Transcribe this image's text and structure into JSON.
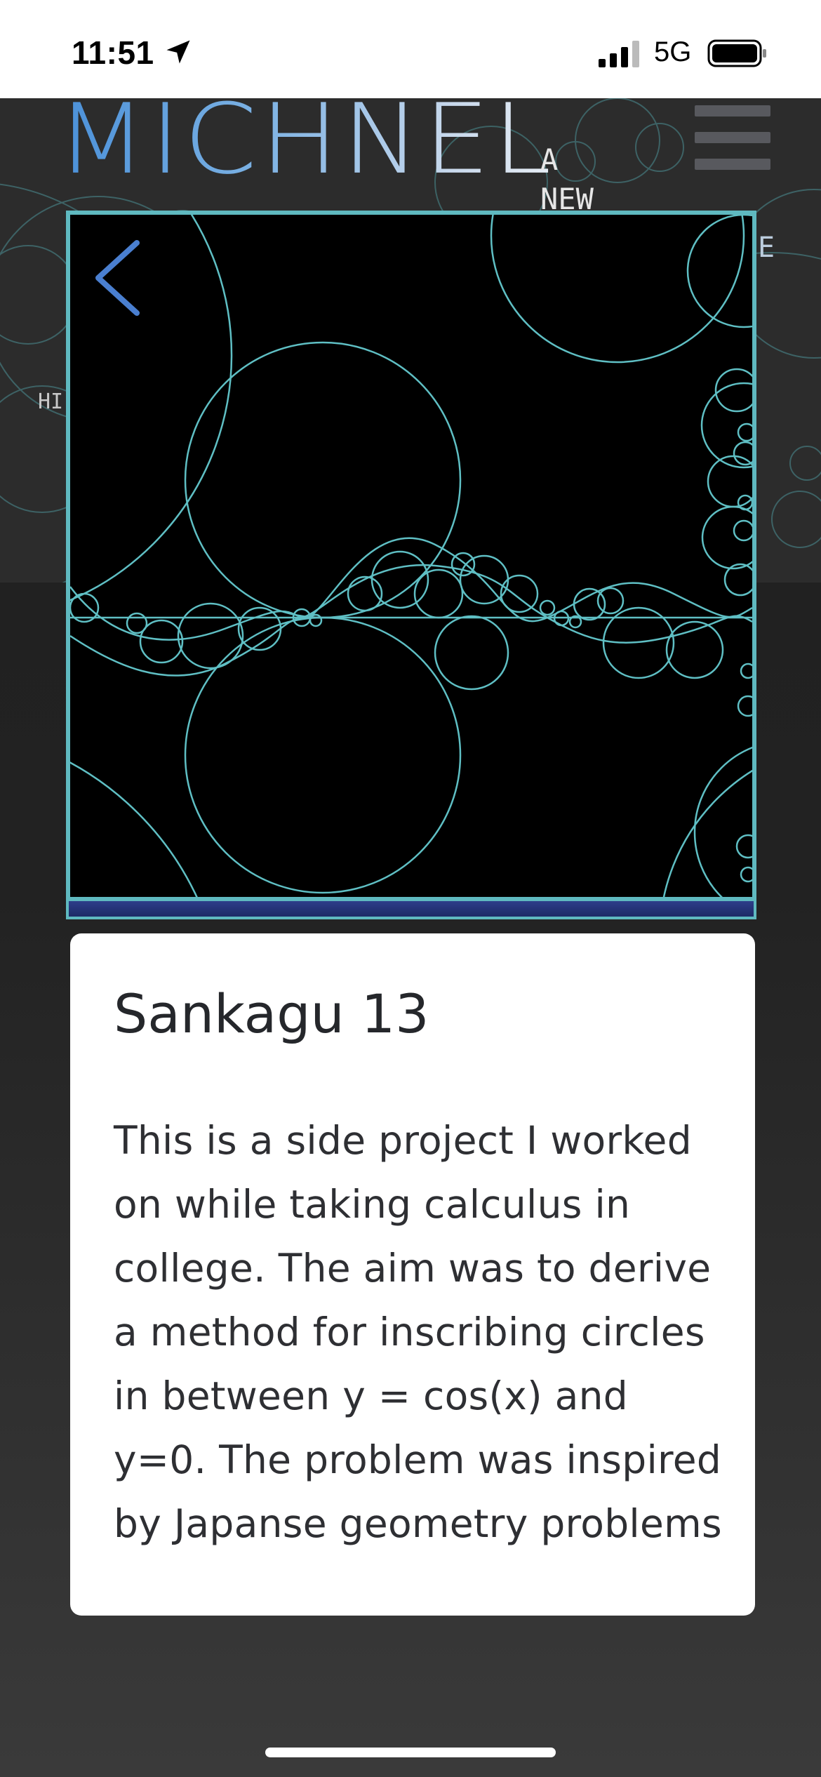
{
  "status_bar": {
    "time": "11:51",
    "network": "5G",
    "icons": [
      "location-arrow-icon",
      "signal-bars-icon",
      "battery-icon"
    ]
  },
  "header": {
    "logo_text": "MICHNEL",
    "tagline": "A NEW",
    "partial_right_letter": "E",
    "partial_left_text": "HI.",
    "menu_icon": "hamburger-menu-icon"
  },
  "modal": {
    "back_icon": "chevron-left-icon",
    "image_description_colors": {
      "stroke": "#5fb9c0",
      "background": "#000000",
      "accent": "#4a90d9"
    }
  },
  "card": {
    "title": "Sankagu 13",
    "body": "This is a side project I worked on while taking calculus in college. The aim was to derive a method for inscribing circles in between y = cos(x) and y=0. The problem was inspired by Japanse geometry problems"
  }
}
